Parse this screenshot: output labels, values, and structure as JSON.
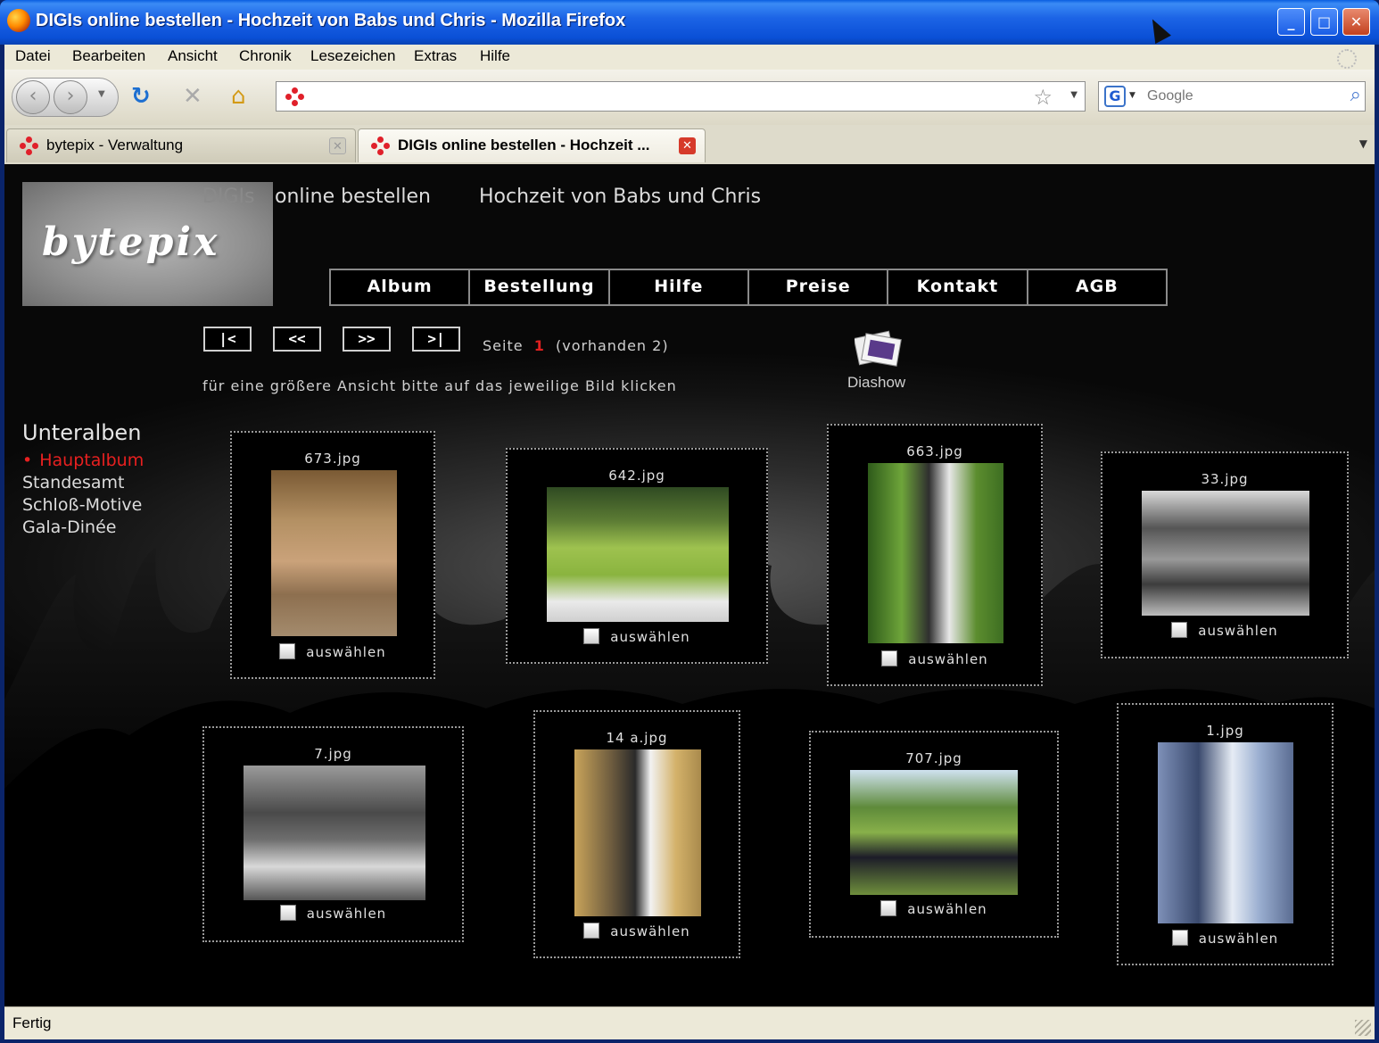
{
  "window": {
    "title": "DIGIs online bestellen - Hochzeit von Babs und Chris - Mozilla Firefox"
  },
  "menu": [
    "Datei",
    "Bearbeiten",
    "Ansicht",
    "Chronik",
    "Lesezeichen",
    "Extras",
    "Hilfe"
  ],
  "navbar": {
    "url": "",
    "search_placeholder": "Google"
  },
  "tabs": [
    {
      "label": "bytepix - Verwaltung",
      "active": false
    },
    {
      "label": "DIGIs online bestellen - Hochzeit ...",
      "active": true
    }
  ],
  "page": {
    "logo": "bytepix",
    "header_digis": "DIGIs",
    "header_online": "online bestellen",
    "header_event": "Hochzeit von Babs und Chris",
    "nav": [
      "Album",
      "Bestellung",
      "Hilfe",
      "Preise",
      "Kontakt",
      "AGB"
    ],
    "pager": {
      "first": "|<",
      "prev": "<<",
      "next": ">>",
      "last": ">|",
      "label": "Seite",
      "current": "1",
      "total": "(vorhanden 2)"
    },
    "hint": "für eine größere Ansicht bitte auf das jeweilige Bild klicken",
    "diashow": "Diashow",
    "subalbums_title": "Unteralben",
    "subalbums": [
      "Hauptalbum",
      "Standesamt",
      "Schloß-Motive",
      "Gala-Dinée"
    ],
    "select_label": "auswählen",
    "photos": [
      {
        "file": "673.jpg"
      },
      {
        "file": "642.jpg"
      },
      {
        "file": "663.jpg"
      },
      {
        "file": "33.jpg"
      },
      {
        "file": "7.jpg"
      },
      {
        "file": "14 a.jpg"
      },
      {
        "file": "707.jpg"
      },
      {
        "file": "1.jpg"
      }
    ]
  },
  "status": "Fertig",
  "colors": {
    "accent": "#e82020",
    "titlebar": "#1c64e6"
  }
}
